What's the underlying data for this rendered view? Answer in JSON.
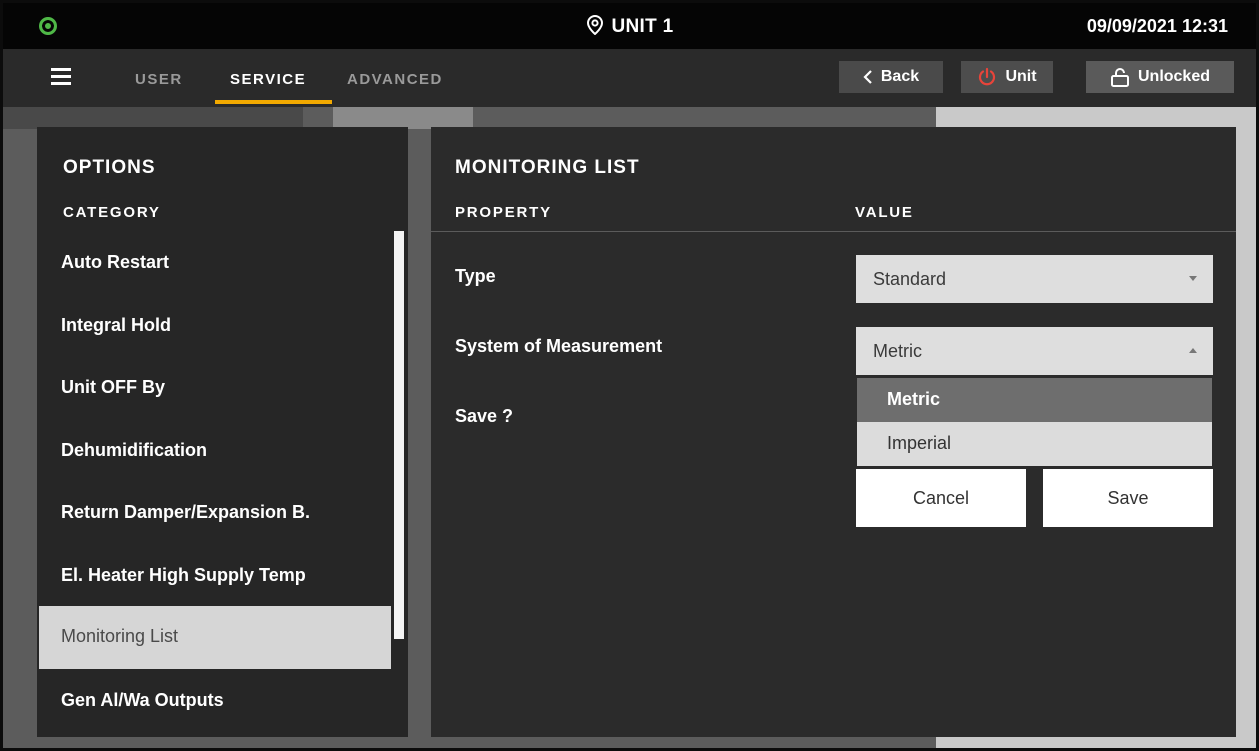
{
  "statusbar": {
    "unit_title": "UNIT 1",
    "datetime": "09/09/2021 12:31",
    "status_color": "#4fb847"
  },
  "nav": {
    "tabs": [
      {
        "label": "USER",
        "active": false
      },
      {
        "label": "SERVICE",
        "active": true
      },
      {
        "label": "ADVANCED",
        "active": false
      }
    ],
    "accent": "#f2a900",
    "back_label": "Back",
    "unit_label": "Unit",
    "unlocked_label": "Unlocked",
    "unit_icon_color": "#e8443a"
  },
  "options": {
    "title": "OPTIONS",
    "category_header": "CATEGORY",
    "items": [
      "Auto Restart",
      "Integral Hold",
      "Unit OFF By",
      "Dehumidification",
      "Return Damper/Expansion B.",
      "El. Heater High Supply Temp",
      "Monitoring List",
      "Gen Al/Wa Outputs"
    ],
    "selected": "Monitoring List"
  },
  "monitoring": {
    "title": "MONITORING LIST",
    "property_header": "PROPERTY",
    "value_header": "VALUE",
    "type_label": "Type",
    "type_value": "Standard",
    "measure_label": "System of Measurement",
    "measure_value": "Metric",
    "measure_options": [
      "Metric",
      "Imperial"
    ],
    "save_label": "Save ?",
    "cancel_button": "Cancel",
    "save_button": "Save"
  }
}
